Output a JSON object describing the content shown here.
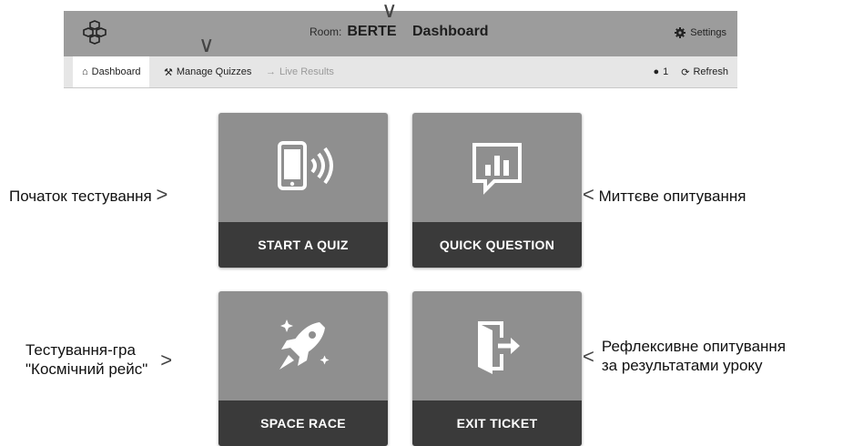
{
  "header": {
    "room_label": "Room:",
    "room_code": "BERTE",
    "page_title": "Dashboard",
    "settings_label": "Settings"
  },
  "tabs": [
    {
      "label": "Dashboard",
      "icon": "home-icon",
      "state": "active"
    },
    {
      "label": "Manage Quizzes",
      "icon": "wrench-icon",
      "state": "normal"
    },
    {
      "label": "Live Results",
      "icon": "arrow-icon",
      "state": "disabled"
    }
  ],
  "status": {
    "students_count": "1",
    "refresh_label": "Refresh"
  },
  "cards": [
    {
      "label": "START A QUIZ",
      "icon": "phone-signal-icon"
    },
    {
      "label": "QUICK QUESTION",
      "icon": "chart-bubble-icon"
    },
    {
      "label": "SPACE RACE",
      "icon": "rocket-icon"
    },
    {
      "label": "EXIT TICKET",
      "icon": "exit-door-icon"
    }
  ],
  "annotations": {
    "start_quiz": "Початок тестування",
    "quick_question": "Миттєве опитування",
    "space_race_line1": "Тестування-гра",
    "space_race_line2": "\"Космічний рейс\"",
    "exit_ticket_line1": "Рефлексивне опитування",
    "exit_ticket_line2": "за результатами уроку"
  },
  "colors": {
    "topbar": "#9c9c9c",
    "card_body": "#8f8f8f",
    "card_label": "#3a3a3a"
  }
}
